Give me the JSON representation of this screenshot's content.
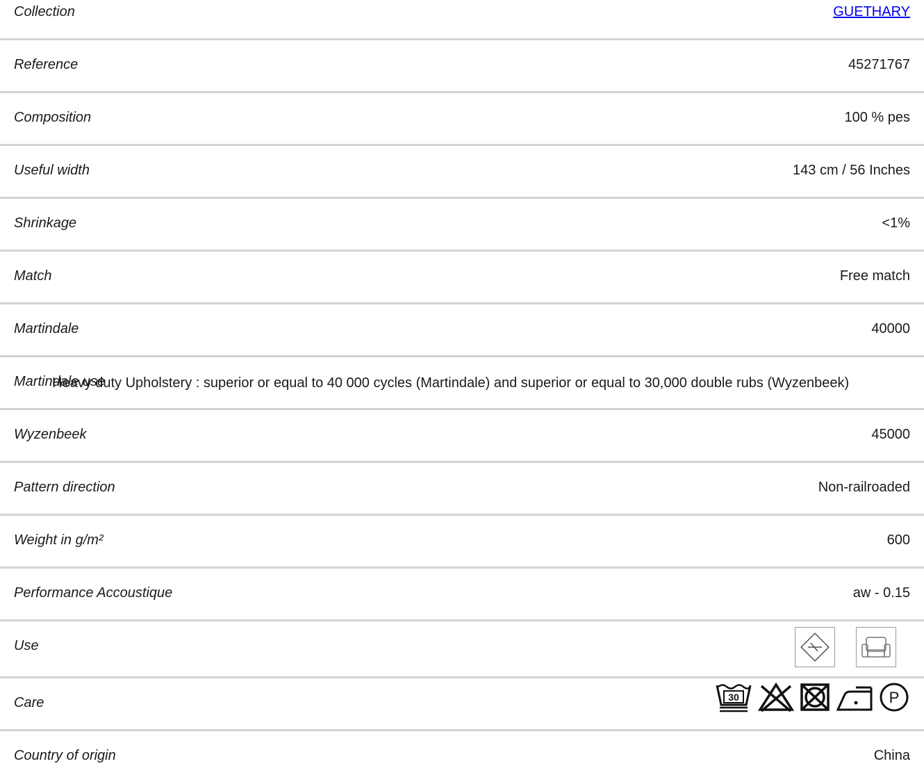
{
  "rows": [
    {
      "label": "Collection",
      "value": "GUETHARY"
    },
    {
      "label": "Reference",
      "value": "45271767"
    },
    {
      "label": "Composition",
      "value": "100 % pes"
    },
    {
      "label": "Useful width",
      "value": "143 cm / 56 Inches"
    },
    {
      "label": "Shrinkage",
      "value": "<1%"
    },
    {
      "label": "Match",
      "value": "Free match"
    },
    {
      "label": "Martindale",
      "value": "40000"
    },
    {
      "label": "Martindale use",
      "value": "Heavy duty Upholstery : superior or equal to 40 000 cycles (Martindale) and superior or equal to 30,000 double rubs (Wyzenbeek)"
    },
    {
      "label": "Wyzenbeek",
      "value": "45000"
    },
    {
      "label": "Pattern direction",
      "value": "Non-railroaded"
    },
    {
      "label": "Weight in g/m²",
      "value": "600"
    },
    {
      "label": "Performance Accoustique",
      "value": "aw - 0.15"
    },
    {
      "label": "Use",
      "icons": [
        "fire-retardant-diamond-icon",
        "armchair-upholstery-icon"
      ]
    },
    {
      "label": "Care",
      "icons": [
        "wash-30-icon",
        "do-not-bleach-icon",
        "do-not-tumble-dry-icon",
        "iron-low-heat-icon",
        "professional-dry-clean-p-icon"
      ],
      "wash_temp": "30",
      "dryclean_letter": "P"
    },
    {
      "label": "Country of origin",
      "value": "China"
    }
  ],
  "colors": {
    "link": "#0000ee",
    "divider": "#d3d3d3",
    "text": "#1a1a1a"
  }
}
